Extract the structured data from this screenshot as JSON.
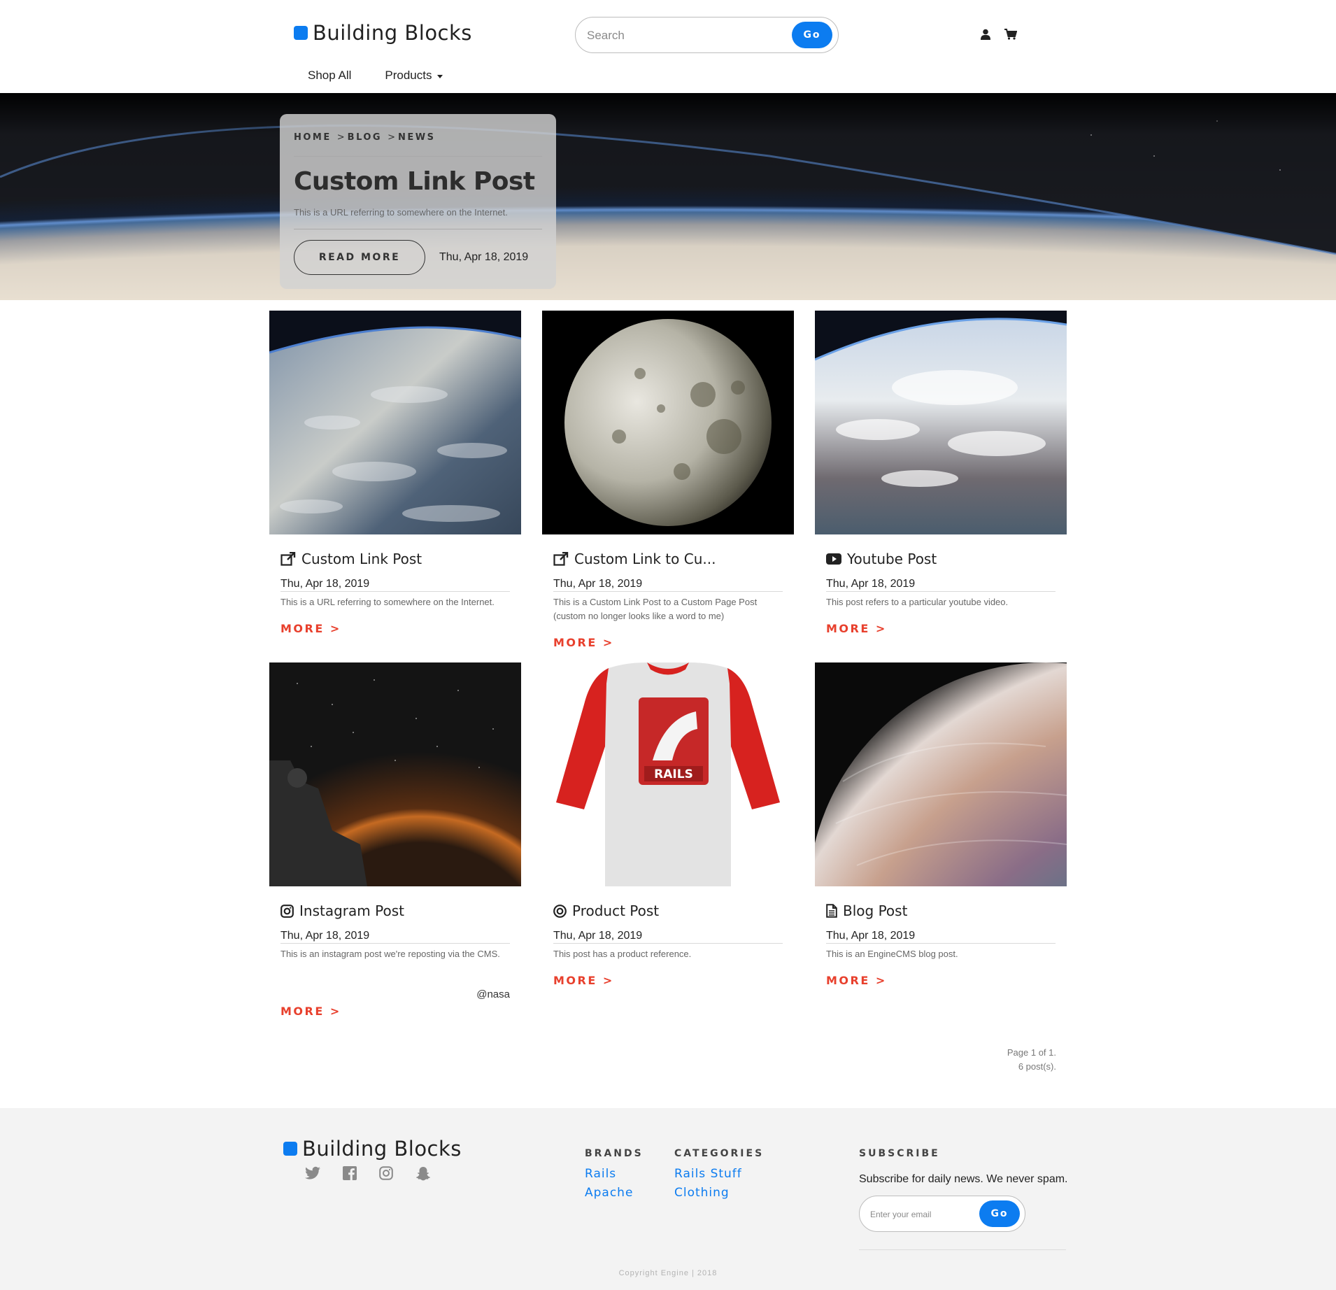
{
  "header": {
    "brand": "Building Blocks",
    "search_placeholder": "Search",
    "search_button": "Go",
    "nav": {
      "shop_all": "Shop All",
      "products": "Products"
    }
  },
  "hero": {
    "breadcrumb": [
      "HOME",
      "BLOG",
      "NEWS"
    ],
    "breadcrumb_separator": ">",
    "title": "Custom Link Post",
    "subtitle": "This is a URL referring to somewhere on the Internet.",
    "button": "READ MORE",
    "date": "Thu, Apr 18, 2019"
  },
  "posts": [
    {
      "icon": "external-link-icon",
      "title": "Custom Link Post",
      "date": "Thu, Apr 18, 2019",
      "desc": "This is a URL referring to somewhere on the Internet.",
      "more": "MORE  >"
    },
    {
      "icon": "external-link-icon",
      "title": "Custom Link to Cu...",
      "date": "Thu, Apr 18, 2019",
      "desc": "This is a Custom Link Post to a Custom Page Post (custom no longer looks like a word to me)",
      "more": "MORE  >"
    },
    {
      "icon": "youtube-icon",
      "title": "Youtube Post",
      "date": "Thu, Apr 18, 2019",
      "desc": "This post refers to a particular youtube video.",
      "more": "MORE  >"
    },
    {
      "icon": "instagram-icon",
      "title": "Instagram Post",
      "date": "Thu, Apr 18, 2019",
      "desc": "This is an instagram post we're reposting via the CMS.",
      "handle": "@nasa",
      "more": "MORE  >"
    },
    {
      "icon": "target-icon",
      "title": "Product Post",
      "date": "Thu, Apr 18, 2019",
      "desc": "This post has a product reference.",
      "more": "MORE  >"
    },
    {
      "icon": "document-icon",
      "title": "Blog Post",
      "date": "Thu, Apr 18, 2019",
      "desc": "This is an EngineCMS blog post.",
      "more": "MORE  >"
    }
  ],
  "pagination": {
    "page": "Page 1 of 1.",
    "count": "6 post(s)."
  },
  "footer": {
    "brand": "Building Blocks",
    "brands_heading": "BRANDS",
    "brands": [
      "Rails",
      "Apache"
    ],
    "categories_heading": "CATEGORIES",
    "categories": [
      "Rails Stuff",
      "Clothing"
    ],
    "subscribe_heading": "SUBSCRIBE",
    "subscribe_text": "Subscribe for daily news. We never spam.",
    "email_placeholder": "Enter your email",
    "email_button": "Go",
    "copyright": "Copyright Engine | 2018"
  },
  "colors": {
    "accent": "#0c7cf0",
    "more_link": "#e8402d",
    "footer_bg": "#f3f3f3"
  }
}
